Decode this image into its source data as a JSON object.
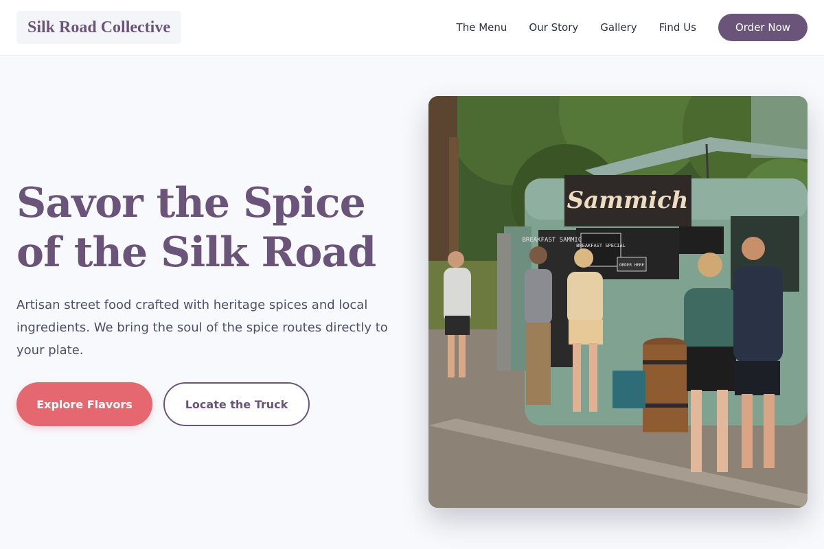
{
  "header": {
    "logo": "Silk Road Collective",
    "nav": [
      "The Menu",
      "Our Story",
      "Gallery",
      "Find Us"
    ],
    "cta": "Order Now"
  },
  "hero": {
    "title_line1": "Savor the Spice",
    "title_line2": "of the Silk Road",
    "subtitle": "Artisan street food crafted with heritage spices and local ingredients. We bring the soul of the spice routes directly to your plate.",
    "primary_button": "Explore Flavors",
    "secondary_button": "Locate the Truck"
  },
  "photo": {
    "sign": "Sammich",
    "board_left": "BREAKFAST SAMMICHES",
    "board_special": "BREAKFAST SPECIAL",
    "board_order": "ORDER HERE"
  },
  "colors": {
    "brand": "#6b5479",
    "accent": "#e5676f",
    "background": "#f8f9fc"
  }
}
